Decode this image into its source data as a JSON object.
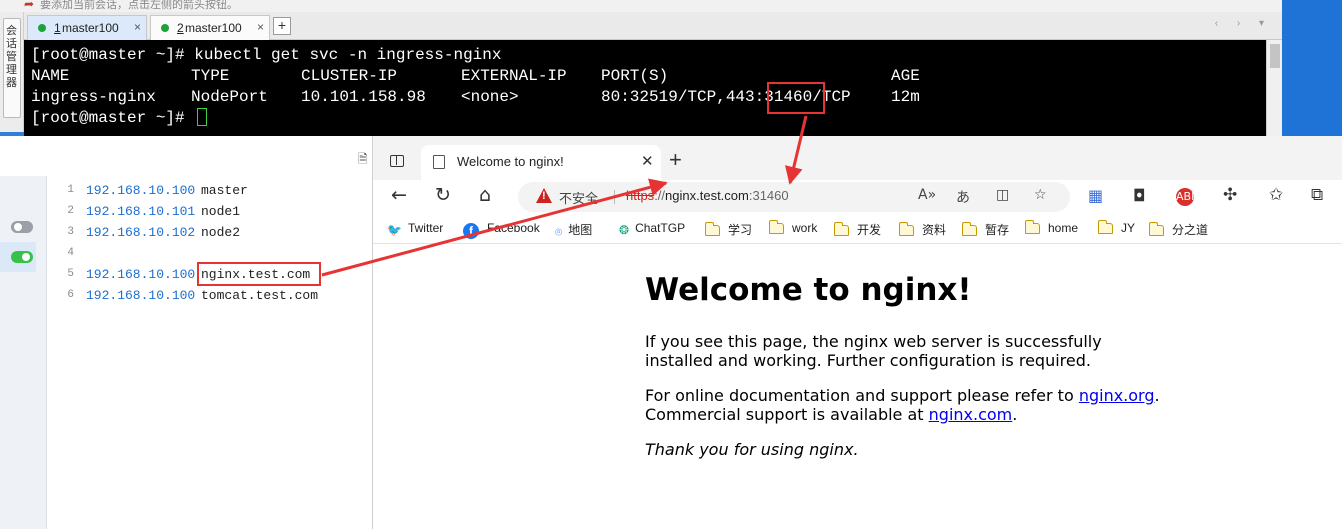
{
  "hint_bar": {
    "text": "要添加当前会话，点击左侧的箭头按钮。"
  },
  "side_strip": {
    "label": "会话管理器"
  },
  "terminal_tabs": [
    {
      "number": "1",
      "label": "master100"
    },
    {
      "number": "2",
      "label": "master100"
    }
  ],
  "terminal": {
    "prompt": "[root@master ~]# ",
    "command": "kubectl get svc -n ingress-nginx",
    "headers": [
      "NAME",
      "TYPE",
      "CLUSTER-IP",
      "EXTERNAL-IP",
      "PORT(S)",
      "AGE"
    ],
    "row": {
      "name": "ingress-nginx",
      "type": "NodePort",
      "cluster_ip": "10.101.158.98",
      "external_ip": "<none>",
      "ports_prefix": "80:32519/TCP,443:",
      "ports_highlight": "31460",
      "ports_suffix": "/TCP",
      "age": "12m"
    }
  },
  "hosts_file": {
    "lines": [
      {
        "num": "1",
        "ip": "192.168.10.100",
        "host": "master"
      },
      {
        "num": "2",
        "ip": "192.168.10.101",
        "host": "node1"
      },
      {
        "num": "3",
        "ip": "192.168.10.102",
        "host": "node2"
      },
      {
        "num": "4",
        "ip": "",
        "host": ""
      },
      {
        "num": "5",
        "ip": "192.168.10.100",
        "host": "nginx.test.com"
      },
      {
        "num": "6",
        "ip": "192.168.10.100",
        "host": "tomcat.test.com"
      }
    ]
  },
  "browser": {
    "tab_title": "Welcome to nginx!",
    "address": {
      "security_label": "不安全",
      "scheme": "https",
      "separator": "://",
      "host": "nginx.test.com",
      "port": ":31460"
    },
    "bookmarks": [
      "Twitter",
      "Facebook",
      "地图",
      "ChatTGP",
      "学习",
      "work",
      "开发",
      "资料",
      "暂存",
      "home",
      "JY",
      "分之道"
    ],
    "page": {
      "heading": "Welcome to nginx!",
      "p1": "If you see this page, the nginx web server is successfully installed and working. Further configuration is required.",
      "p2_prefix": "For online documentation and support please refer to ",
      "p2_link1": "nginx.org",
      "p2_mid": ". Commercial support is available at ",
      "p2_link2": "nginx.com",
      "p2_suffix": ".",
      "p3": "Thank you for using nginx."
    }
  },
  "colors": {
    "annotation": "#e63434",
    "terminal_bg": "#000000",
    "hosts_ip": "#1d6fd1",
    "link": "#0000ee"
  }
}
